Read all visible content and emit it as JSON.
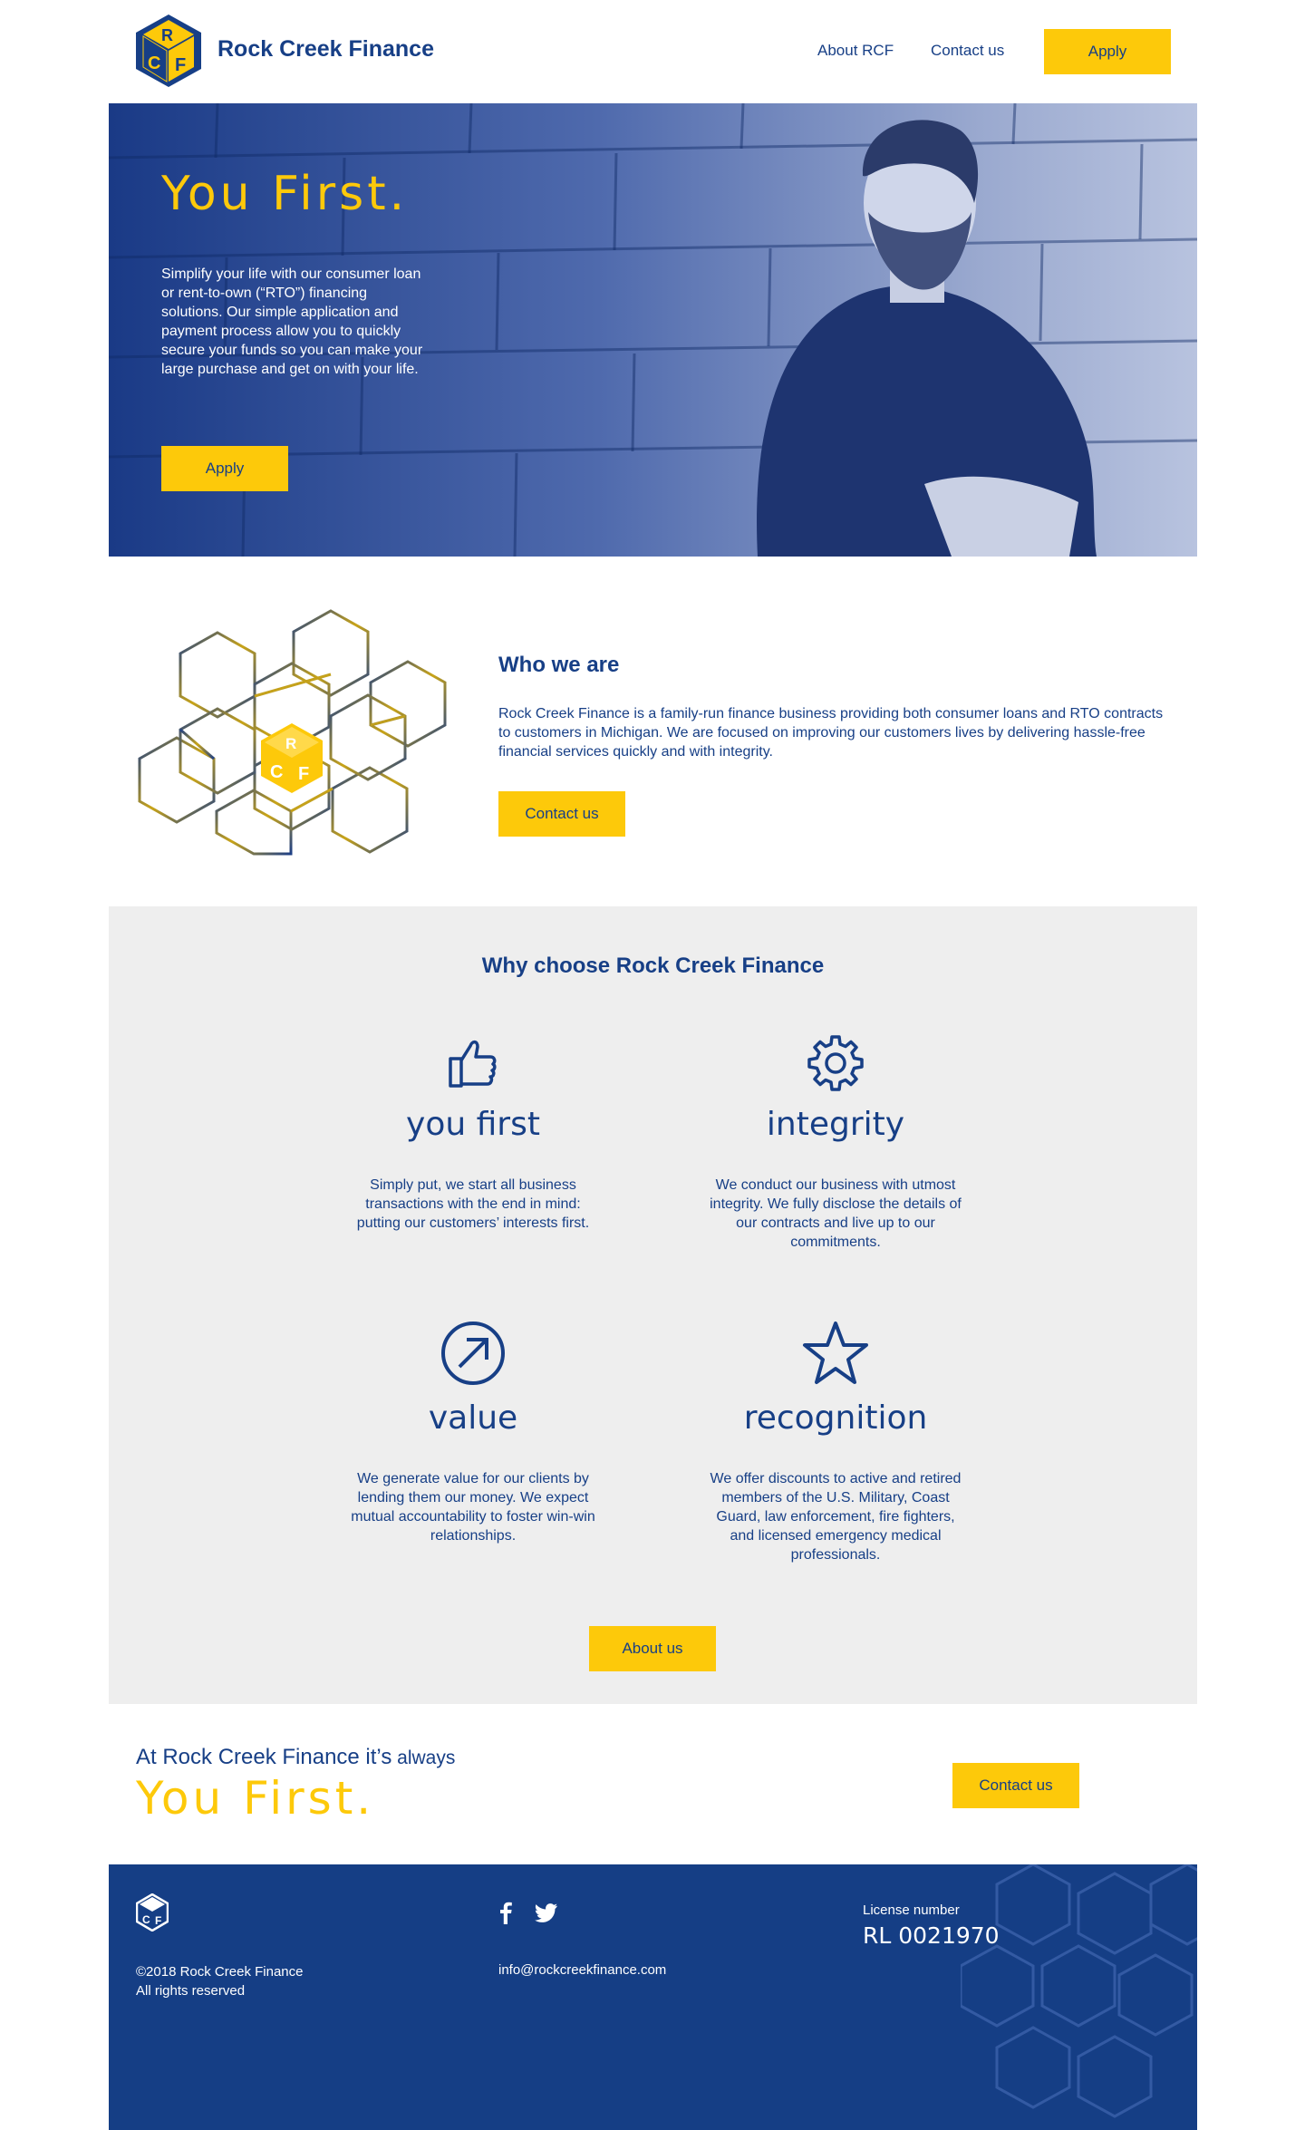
{
  "colors": {
    "navy": "#173f86",
    "yellow": "#fdc90a",
    "panel": "#eeeeee",
    "footer": "#153e85"
  },
  "header": {
    "brand": "Rock Creek Finance",
    "logo_letters": "RCF",
    "nav": {
      "about": "About RCF",
      "contact": "Contact us",
      "apply": "Apply"
    }
  },
  "hero": {
    "title": "You First.",
    "text": "Simplify your life with our consumer loan or rent-to-own (“RTO”) financing solutions.  Our simple application and payment process allow you to quickly secure your funds so you can make your large purchase and get on with your life.",
    "apply": "Apply"
  },
  "who": {
    "title": "Who we are",
    "text": "Rock Creek Finance is a family-run finance business providing both consumer loans and RTO contracts to customers in Michigan.  We are focused on improving our customers lives by delivering hassle-free financial services quickly and with integrity.",
    "contact": "Contact us"
  },
  "why": {
    "title": "Why choose Rock Creek Finance",
    "features": [
      {
        "icon": "thumbs-up-icon",
        "title": "you first",
        "text": "Simply put, we start all business transactions with the end in mind: putting our customers’ interests first."
      },
      {
        "icon": "gear-icon",
        "title": "integrity",
        "text": "We conduct our business with utmost integrity.  We fully disclose the details of our contracts and live up to our commitments."
      },
      {
        "icon": "arrow-circle-icon",
        "title": "value",
        "text": "We generate value for our clients by lending them our money.  We expect mutual accountability to foster win-win relationships."
      },
      {
        "icon": "star-icon",
        "title": "recognition",
        "text": "We offer discounts to active and retired members of the U.S. Military, Coast Guard, law enforcement, fire fighters, and licensed emergency medical professionals."
      }
    ],
    "about": "About us"
  },
  "always": {
    "line_start": "At Rock Creek Finance it’s",
    "line_end": " always",
    "big": "You First.",
    "contact": "Contact us"
  },
  "footer": {
    "copyright": "©2018 Rock Creek Finance",
    "rights": "All rights reserved",
    "email": "info@rockcreekfinance.com",
    "license_label": "License number",
    "license_number": "RL 0021970",
    "social": [
      "facebook-icon",
      "twitter-icon"
    ]
  }
}
